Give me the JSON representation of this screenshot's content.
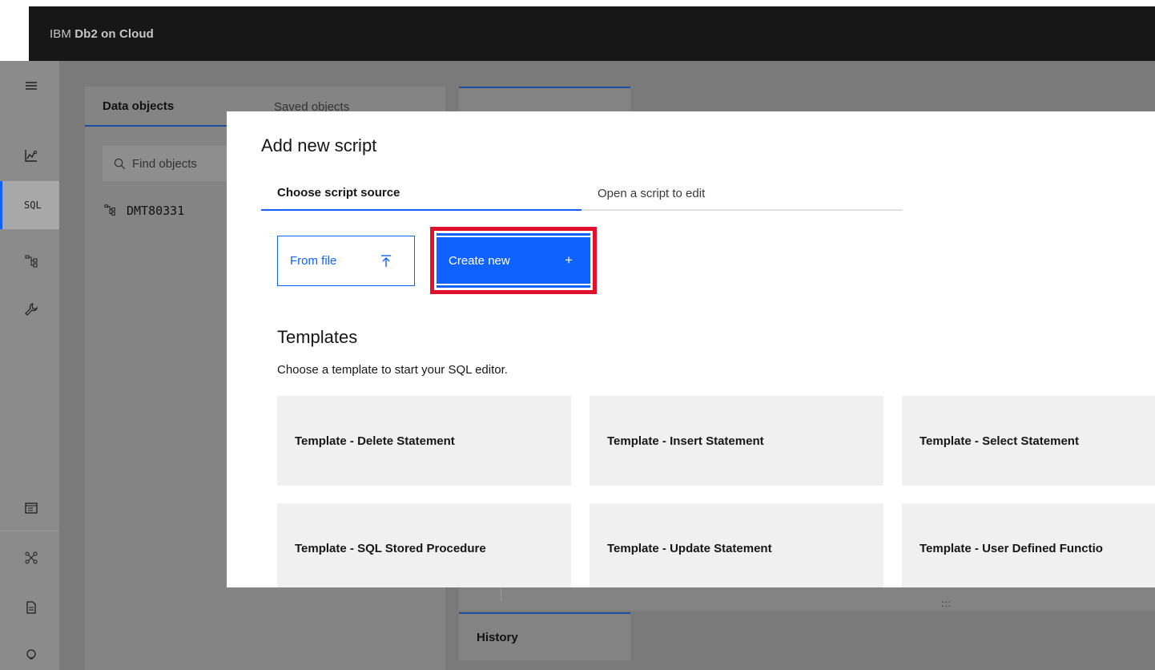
{
  "app": {
    "brand_prefix": "IBM ",
    "brand_name": "Db2 on Cloud"
  },
  "rail": {
    "sql_label": "SQL"
  },
  "background": {
    "tab_data_objects": "Data objects",
    "tab_saved_objects": "Saved objects",
    "search_placeholder": "Find objects",
    "tree_item": "DMT80331",
    "history_tab": "History",
    "grip": ":::"
  },
  "modal": {
    "title": "Add new script",
    "tabs": [
      {
        "label": "Choose script source"
      },
      {
        "label": "Open a script to edit"
      }
    ],
    "from_file_label": "From file",
    "create_new_label": "Create new",
    "create_new_icon": "+",
    "templates_heading": "Templates",
    "templates_subtitle": "Choose a template to start your SQL editor.",
    "templates": [
      "Template - Delete Statement",
      "Template - Insert Statement",
      "Template - Select Statement",
      "Template - SQL Stored Procedure",
      "Template - Update Statement",
      "Template - User Defined Functio"
    ]
  },
  "colors": {
    "accent": "#0f62fe",
    "highlight": "#e1112e",
    "topbar": "#171717"
  }
}
